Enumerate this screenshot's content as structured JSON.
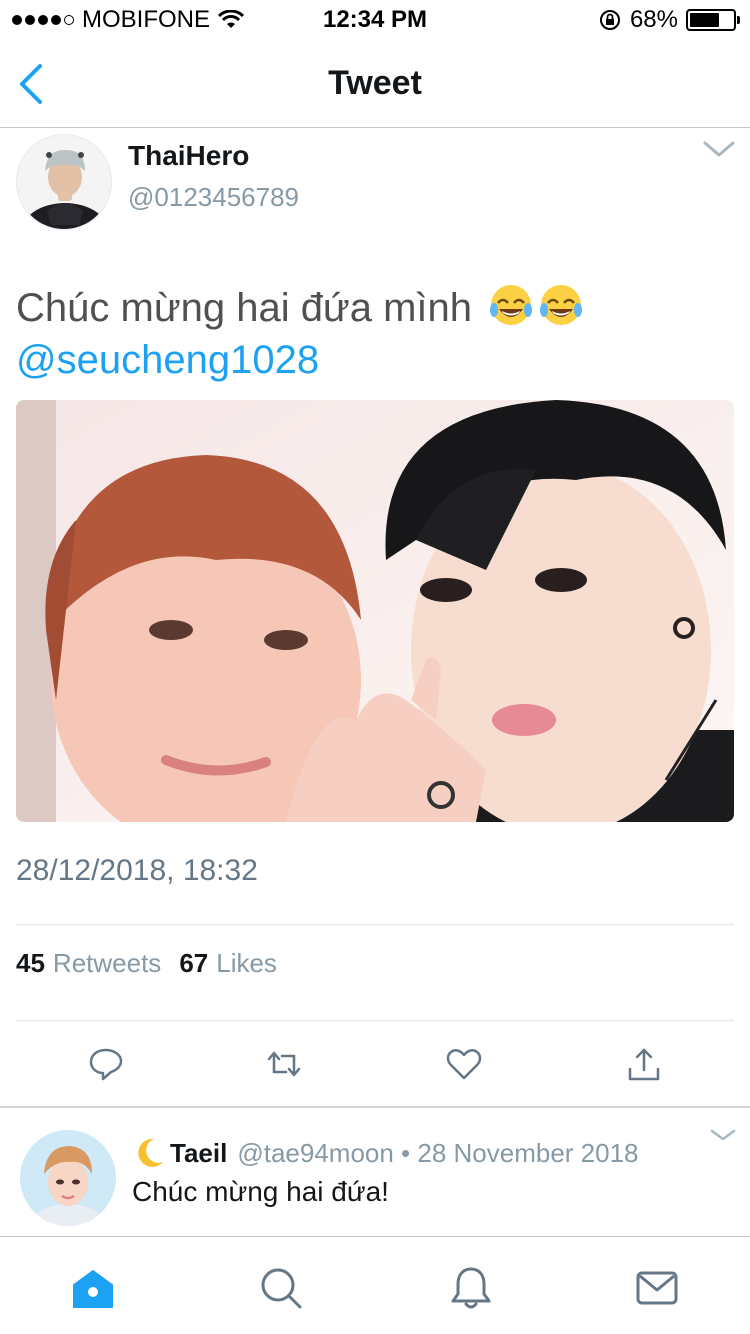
{
  "status_bar": {
    "carrier": "MOBIFONE",
    "time": "12:34 PM",
    "battery_pct": "68%",
    "battery_level": 0.68
  },
  "nav": {
    "title": "Tweet",
    "back_icon": "chevron-left-icon"
  },
  "tweet": {
    "author_name": "ThaiHero",
    "author_handle": "@0123456789",
    "text": "Chúc mừng hai đứa mình",
    "emojis": [
      "tears-of-joy-emoji",
      "tears-of-joy-emoji"
    ],
    "mention": "@seucheng1028",
    "timestamp": "28/12/2018, 18:32",
    "retweets_count": "45",
    "retweets_label": "Retweets",
    "likes_count": "67",
    "likes_label": "Likes"
  },
  "actions": [
    "reply-icon",
    "retweet-icon",
    "like-icon",
    "share-icon"
  ],
  "reply": {
    "name": "Taeil",
    "handle_date": "@tae94moon • 28 November 2018",
    "text": "Chúc mừng hai đứa!"
  },
  "tabs": [
    "home-icon",
    "search-icon",
    "notifications-icon",
    "messages-icon"
  ],
  "colors": {
    "accent": "#1da1f2",
    "text_primary": "#14171a",
    "text_secondary": "#8899a6"
  }
}
